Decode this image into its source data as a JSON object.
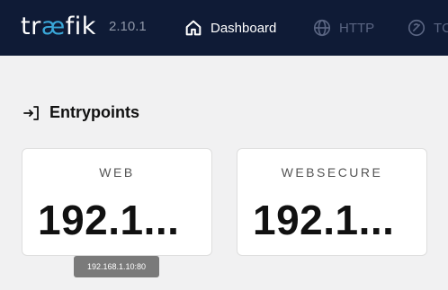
{
  "header": {
    "logo_prefix": "tr",
    "logo_ae": "æ",
    "logo_suffix": "fik",
    "version": "2.10.1",
    "nav": [
      {
        "label": "Dashboard",
        "icon": "home-icon",
        "active": true
      },
      {
        "label": "HTTP",
        "icon": "globe-icon",
        "active": false
      },
      {
        "label": "TC",
        "icon": "tcp-icon",
        "active": false
      }
    ]
  },
  "entrypoints": {
    "title": "Entrypoints",
    "icon": "login-arrow-icon",
    "cards": [
      {
        "name": "WEB",
        "value": "192.1..."
      },
      {
        "name": "WEBSECURE",
        "value": "192.1..."
      }
    ]
  },
  "tooltip": {
    "text": "192.168.1.10:80"
  },
  "colors": {
    "topbar": "#0f1b36",
    "background": "#f1f1f2",
    "logo_accent": "#3aa7d8",
    "nav_inactive": "#5a6582",
    "tooltip_bg": "#7a7a7a"
  }
}
